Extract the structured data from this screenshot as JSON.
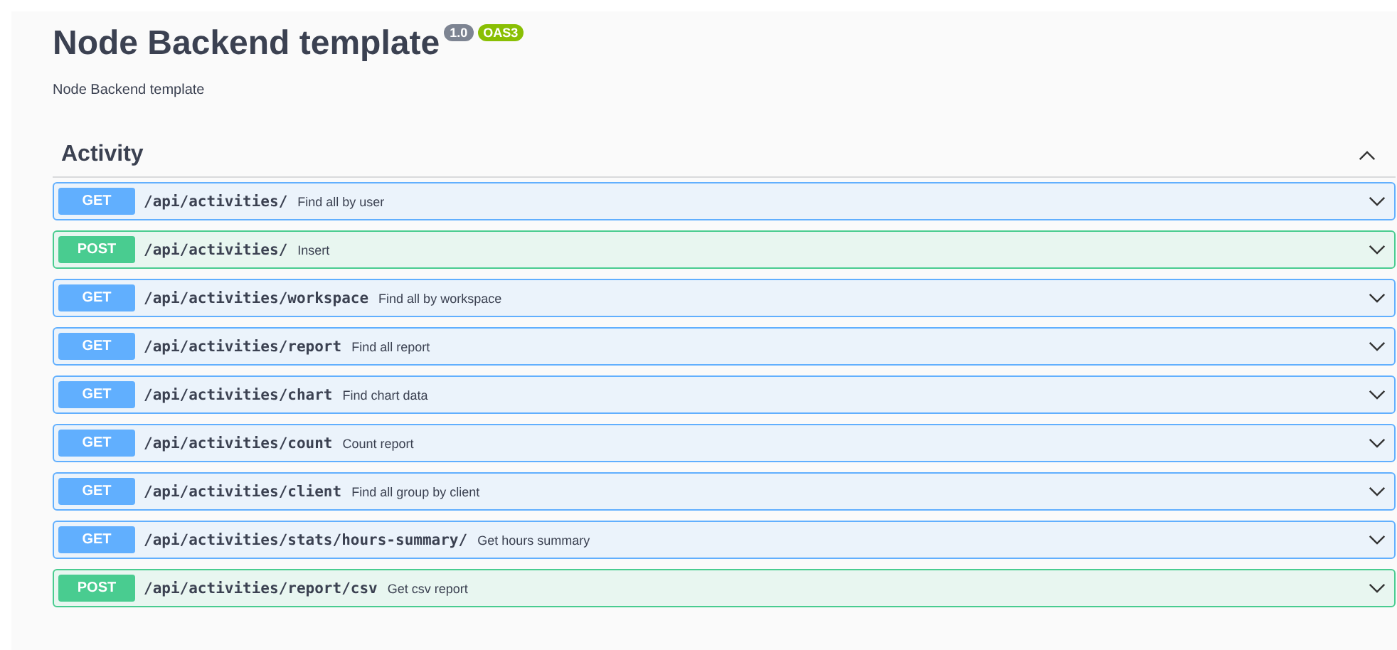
{
  "title": "Node Backend template",
  "version": "1.0",
  "spec_badge": "OAS3",
  "description": "Node Backend template",
  "section": {
    "name": "Activity",
    "expanded": true,
    "operations": [
      {
        "method": "GET",
        "path": "/api/activities/",
        "summary": "Find all by user",
        "expanded": false
      },
      {
        "method": "POST",
        "path": "/api/activities/",
        "summary": "Insert",
        "expanded": false
      },
      {
        "method": "GET",
        "path": "/api/activities/workspace",
        "summary": "Find all by workspace",
        "expanded": false
      },
      {
        "method": "GET",
        "path": "/api/activities/report",
        "summary": "Find all report",
        "expanded": false
      },
      {
        "method": "GET",
        "path": "/api/activities/chart",
        "summary": "Find chart data",
        "expanded": false
      },
      {
        "method": "GET",
        "path": "/api/activities/count",
        "summary": "Count report",
        "expanded": false
      },
      {
        "method": "GET",
        "path": "/api/activities/client",
        "summary": "Find all group by client",
        "expanded": false
      },
      {
        "method": "GET",
        "path": "/api/activities/stats/hours-summary/",
        "summary": "Get hours summary",
        "expanded": false
      },
      {
        "method": "POST",
        "path": "/api/activities/report/csv",
        "summary": "Get csv report",
        "expanded": false
      }
    ]
  }
}
